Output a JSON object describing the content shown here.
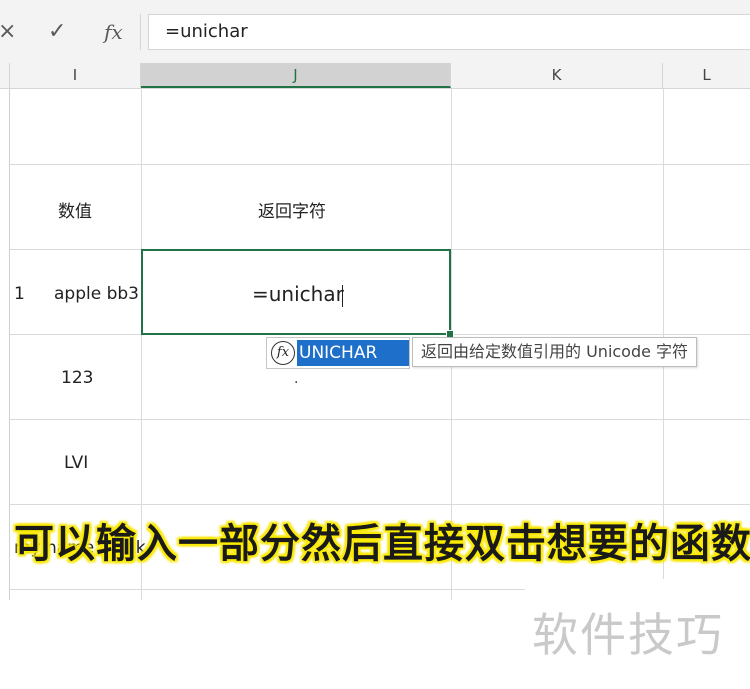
{
  "formula_bar": {
    "cancel_icon": "×",
    "enter_icon": "✓",
    "fx_label": "fx",
    "formula": "=unichar"
  },
  "columns": [
    "I",
    "J",
    "K",
    "L"
  ],
  "selected_column": "J",
  "cells": {
    "I_header": "数值",
    "J_header": "返回字符",
    "row_marker": "1",
    "I_row1": "apple bb3",
    "J_row1_editing": "=unichar",
    "I_row2": "123",
    "I_row3": "LVI",
    "I_row4": "my name is otk"
  },
  "autocomplete": {
    "icon": "fx",
    "item": "UNICHAR",
    "tooltip": "返回由给定数值引用的 Unicode 字符",
    "marker": "."
  },
  "caption": "可以输入一部分然后直接双击想要的函数",
  "watermark": "软件技巧"
}
